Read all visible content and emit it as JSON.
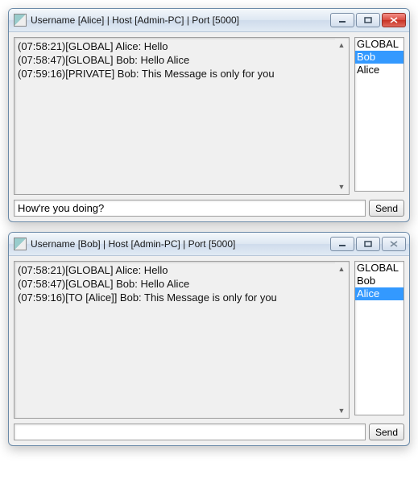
{
  "windows": [
    {
      "id": "alice",
      "title": "Username [Alice] | Host [Admin-PC] | Port [5000]",
      "close_style": "red",
      "messages": [
        "(07:58:21)[GLOBAL] Alice: Hello",
        "(07:58:47)[GLOBAL] Bob: Hello Alice",
        "(07:59:16)[PRIVATE] Bob: This Message is only for you"
      ],
      "users": [
        "GLOBAL",
        "Bob",
        "Alice"
      ],
      "selected_user_index": 1,
      "input_value": "How're you doing?",
      "send_label": "Send"
    },
    {
      "id": "bob",
      "title": "Username [Bob] | Host [Admin-PC] | Port [5000]",
      "close_style": "gray",
      "messages": [
        "(07:58:21)[GLOBAL] Alice: Hello",
        "(07:58:47)[GLOBAL] Bob: Hello Alice",
        "(07:59:16)[TO [Alice]] Bob: This Message is only for you"
      ],
      "users": [
        "GLOBAL",
        "Bob",
        "Alice"
      ],
      "selected_user_index": 2,
      "input_value": "",
      "send_label": "Send"
    }
  ]
}
